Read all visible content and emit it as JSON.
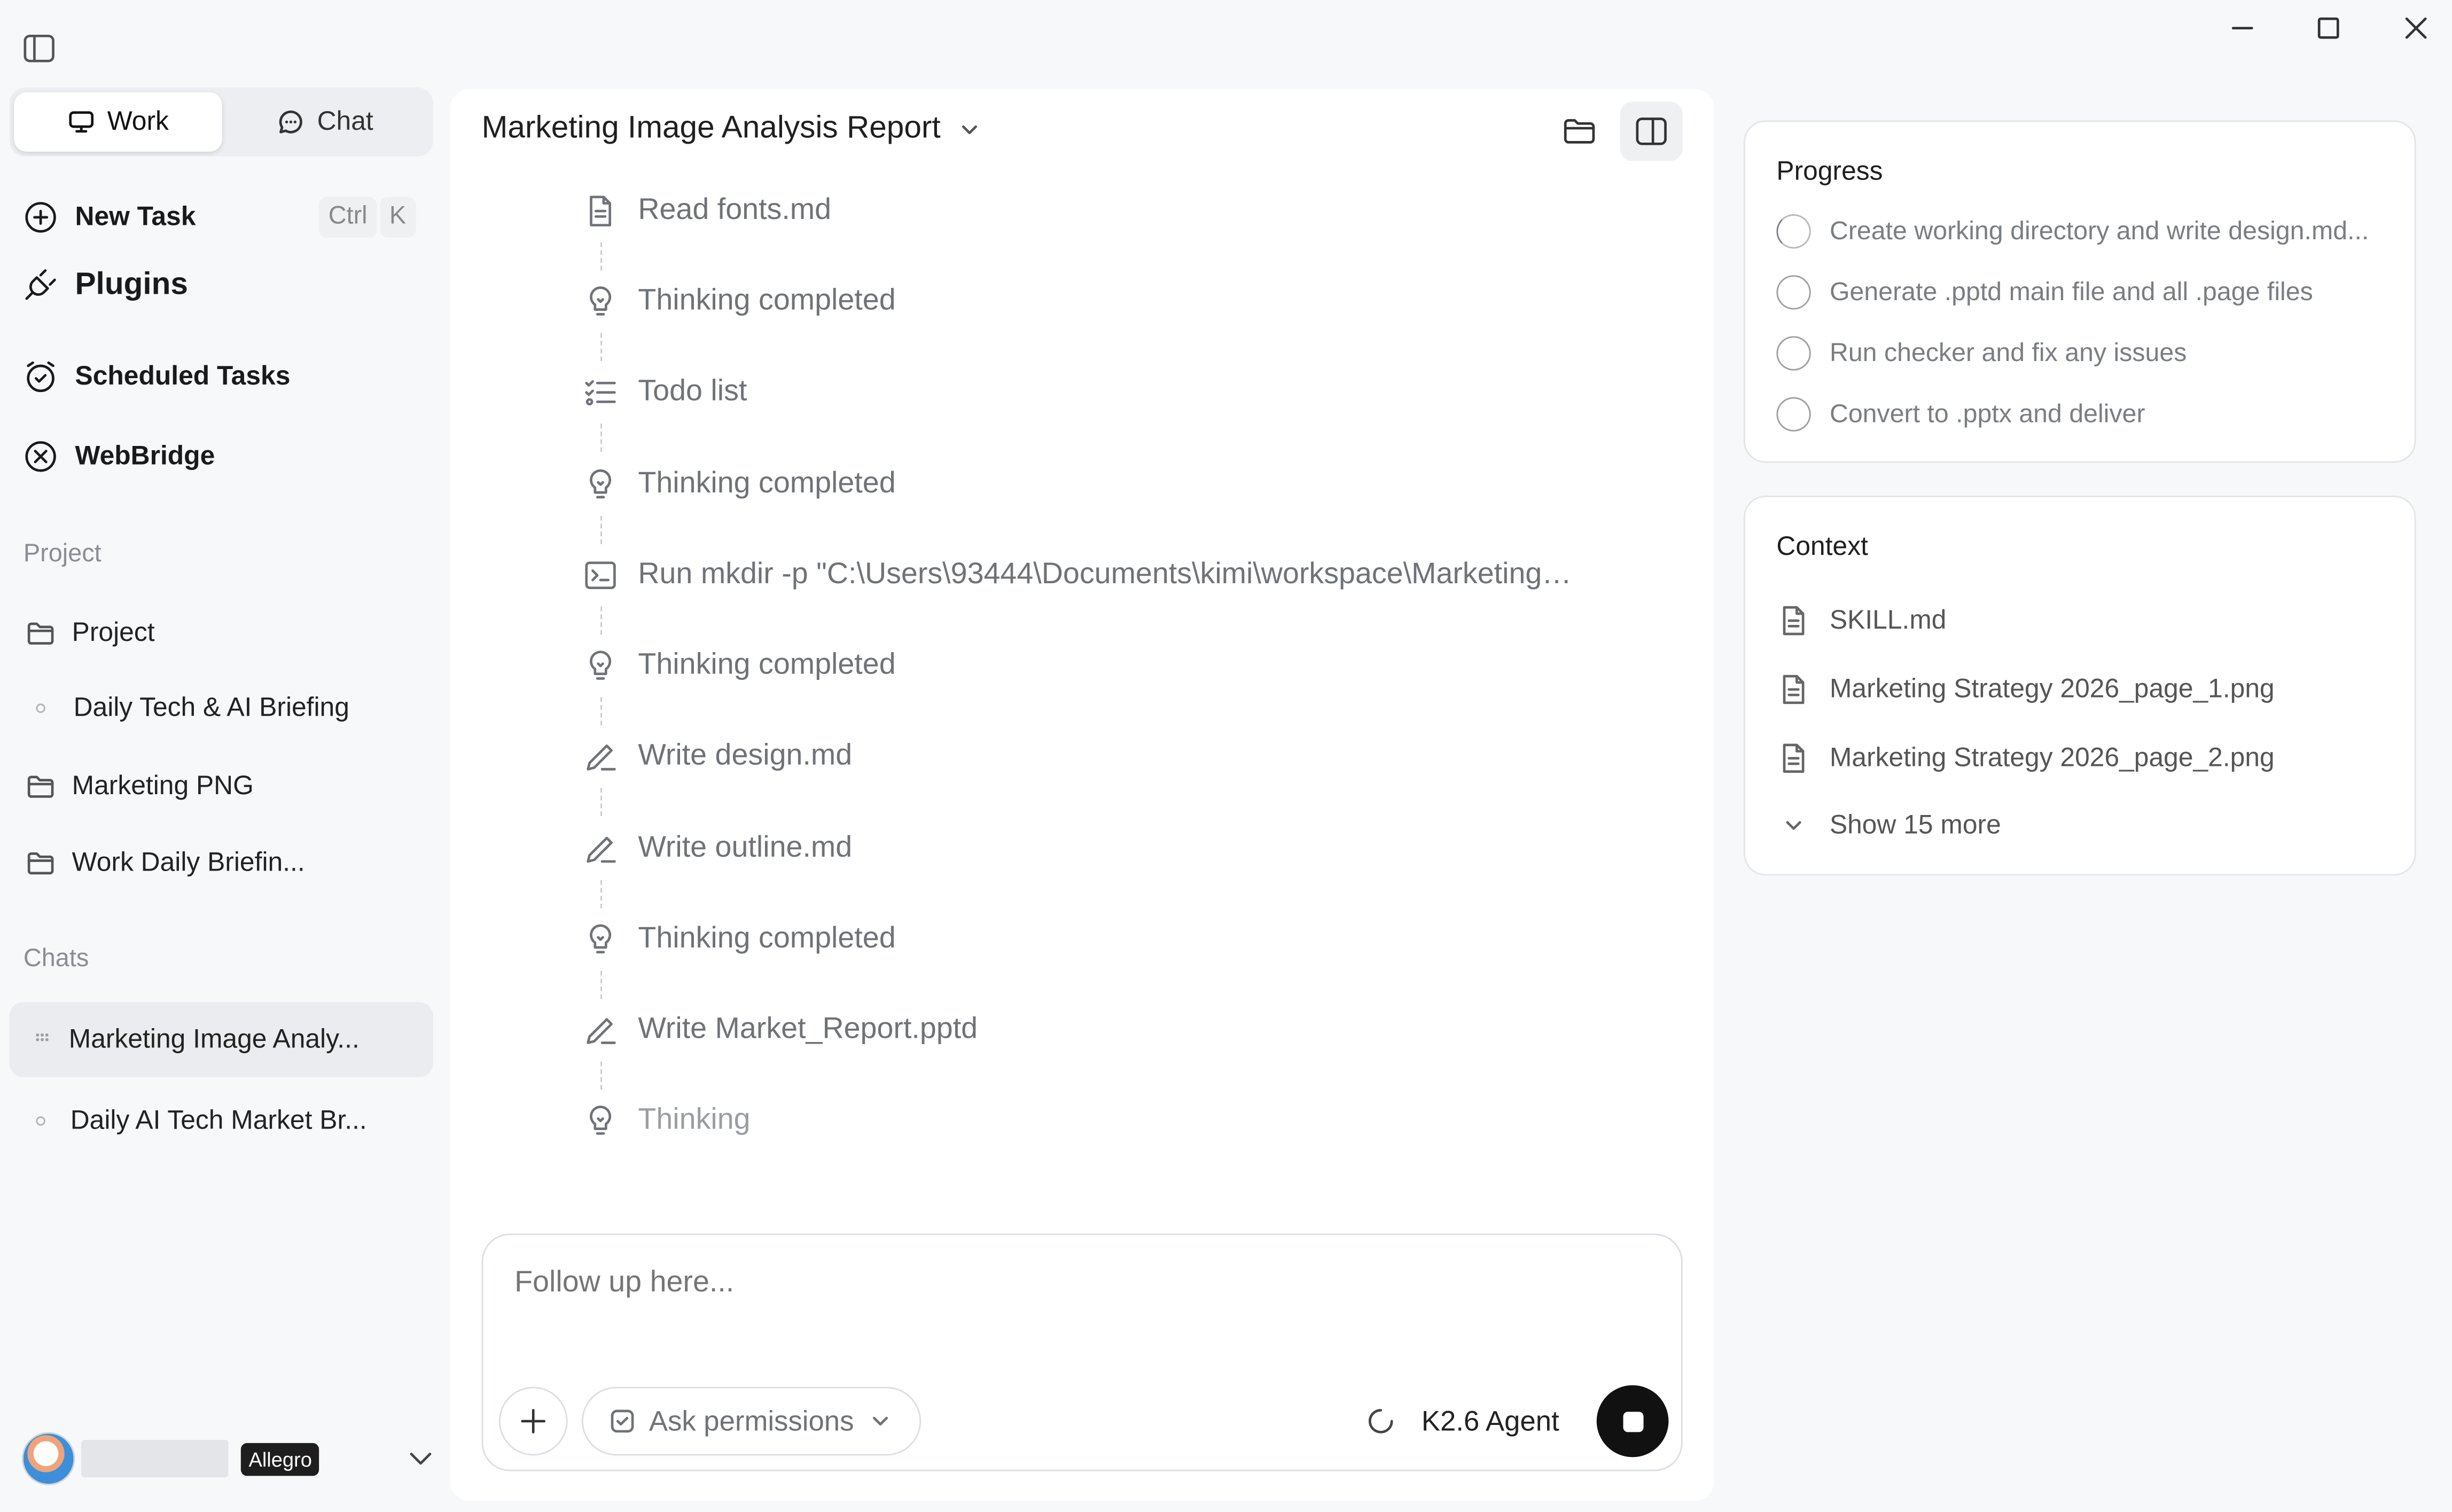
{
  "sidebar": {
    "mode_tabs": [
      {
        "label": "Work",
        "icon": "monitor-icon",
        "active": true
      },
      {
        "label": "Chat",
        "icon": "chat-bubble-icon",
        "active": false
      }
    ],
    "new_task": {
      "label": "New Task",
      "shortcut_ctrl": "Ctrl",
      "shortcut_key": "K"
    },
    "plugins": {
      "label": "Plugins"
    },
    "scheduled_tasks": {
      "label": "Scheduled Tasks"
    },
    "webbridge": {
      "label": "WebBridge"
    },
    "project_section": {
      "label": "Project",
      "items": [
        {
          "label": "Project",
          "type": "folder"
        },
        {
          "label": "Daily Tech & AI Briefing",
          "type": "item"
        },
        {
          "label": "Marketing PNG",
          "type": "folder"
        },
        {
          "label": "Work Daily Briefin...",
          "type": "folder"
        }
      ]
    },
    "chats_section": {
      "label": "Chats",
      "items": [
        {
          "label": "Marketing Image Analy...",
          "active": true
        },
        {
          "label": "Daily AI Tech Market Br...",
          "active": false
        }
      ]
    },
    "user": {
      "plan": "Allegro"
    }
  },
  "main": {
    "title": "Marketing Image Analysis Report",
    "steps": [
      {
        "label": "Read fonts.md",
        "icon": "file-icon"
      },
      {
        "label": "Thinking completed",
        "icon": "lightbulb-icon"
      },
      {
        "label": "Todo list",
        "icon": "todo-list-icon"
      },
      {
        "label": "Thinking completed",
        "icon": "lightbulb-icon"
      },
      {
        "label": "Run mkdir -p \"C:\\Users\\93444\\Documents\\kimi\\workspace\\Marketing…",
        "icon": "terminal-icon"
      },
      {
        "label": "Thinking completed",
        "icon": "lightbulb-icon"
      },
      {
        "label": "Write design.md",
        "icon": "pen-icon"
      },
      {
        "label": "Write outline.md",
        "icon": "pen-icon"
      },
      {
        "label": "Thinking completed",
        "icon": "lightbulb-icon"
      },
      {
        "label": "Write Market_Report.pptd",
        "icon": "pen-icon"
      },
      {
        "label": "Thinking",
        "icon": "lightbulb-icon"
      }
    ],
    "composer": {
      "placeholder": "Follow up here...",
      "permissions_label": "Ask permissions",
      "agent_label": "K2.6 Agent"
    }
  },
  "progress": {
    "title": "Progress",
    "items": [
      {
        "label": "Create working directory and write design.md...",
        "status": "running"
      },
      {
        "label": "Generate .pptd main file and all .page files",
        "status": "pending"
      },
      {
        "label": "Run checker and fix any issues",
        "status": "pending"
      },
      {
        "label": "Convert to .pptx and deliver",
        "status": "pending"
      }
    ]
  },
  "context": {
    "title": "Context",
    "files": [
      {
        "label": "SKILL.md"
      },
      {
        "label": "Marketing Strategy 2026_page_1.png"
      },
      {
        "label": "Marketing Strategy 2026_page_2.png"
      }
    ],
    "show_more": "Show 15 more"
  }
}
